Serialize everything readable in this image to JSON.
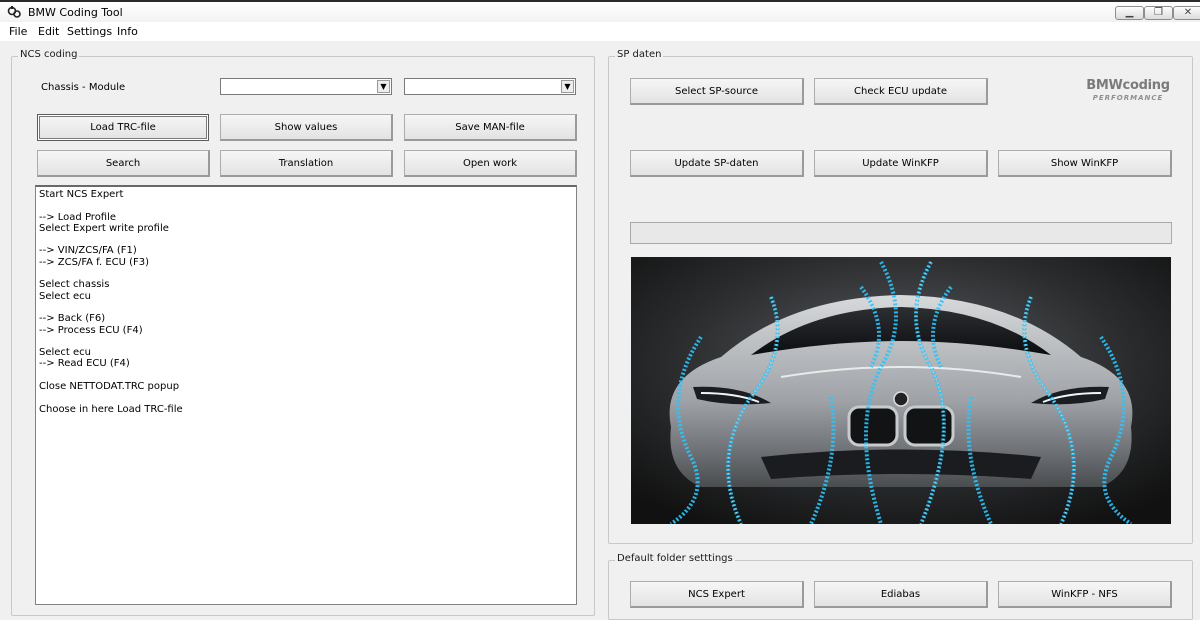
{
  "window": {
    "title": "BMW Coding Tool",
    "icon": "app-icon"
  },
  "menu": [
    "File",
    "Edit",
    "Settings",
    "Info"
  ],
  "ncs": {
    "group_label": "NCS coding",
    "chassis_label": "Chassis - Module",
    "chassis_value": "",
    "module_value": "",
    "buttons": {
      "load_trc": "Load TRC-file",
      "show_values": "Show values",
      "save_man": "Save MAN-file",
      "search": "Search",
      "translation": "Translation",
      "open_work": "Open work"
    },
    "log_text": "Start NCS Expert\n\n--> Load Profile\nSelect Expert write profile\n\n--> VIN/ZCS/FA (F1)\n--> ZCS/FA f. ECU (F3)\n\nSelect chassis\nSelect ecu\n\n--> Back (F6)\n--> Process ECU (F4)\n\nSelect ecu\n--> Read ECU (F4)\n\nClose NETTODAT.TRC popup\n\nChoose in here Load TRC-file"
  },
  "sp": {
    "group_label": "SP daten",
    "buttons": {
      "select_source": "Select SP-source",
      "check_ecu": "Check ECU update",
      "update_sp": "Update SP-daten",
      "update_winkfp": "Update WinKFP",
      "show_winkfp": "Show WinKFP"
    },
    "logo_main": "BMWcoding",
    "logo_sub": "PERFORMANCE",
    "progress": 0
  },
  "folders": {
    "group_label": "Default folder setttings",
    "buttons": [
      "NCS Expert",
      "Ediabas",
      "WinKFP - NFS"
    ]
  },
  "colors": {
    "accent": "#29c6ff",
    "background": "#f0f0f0"
  }
}
